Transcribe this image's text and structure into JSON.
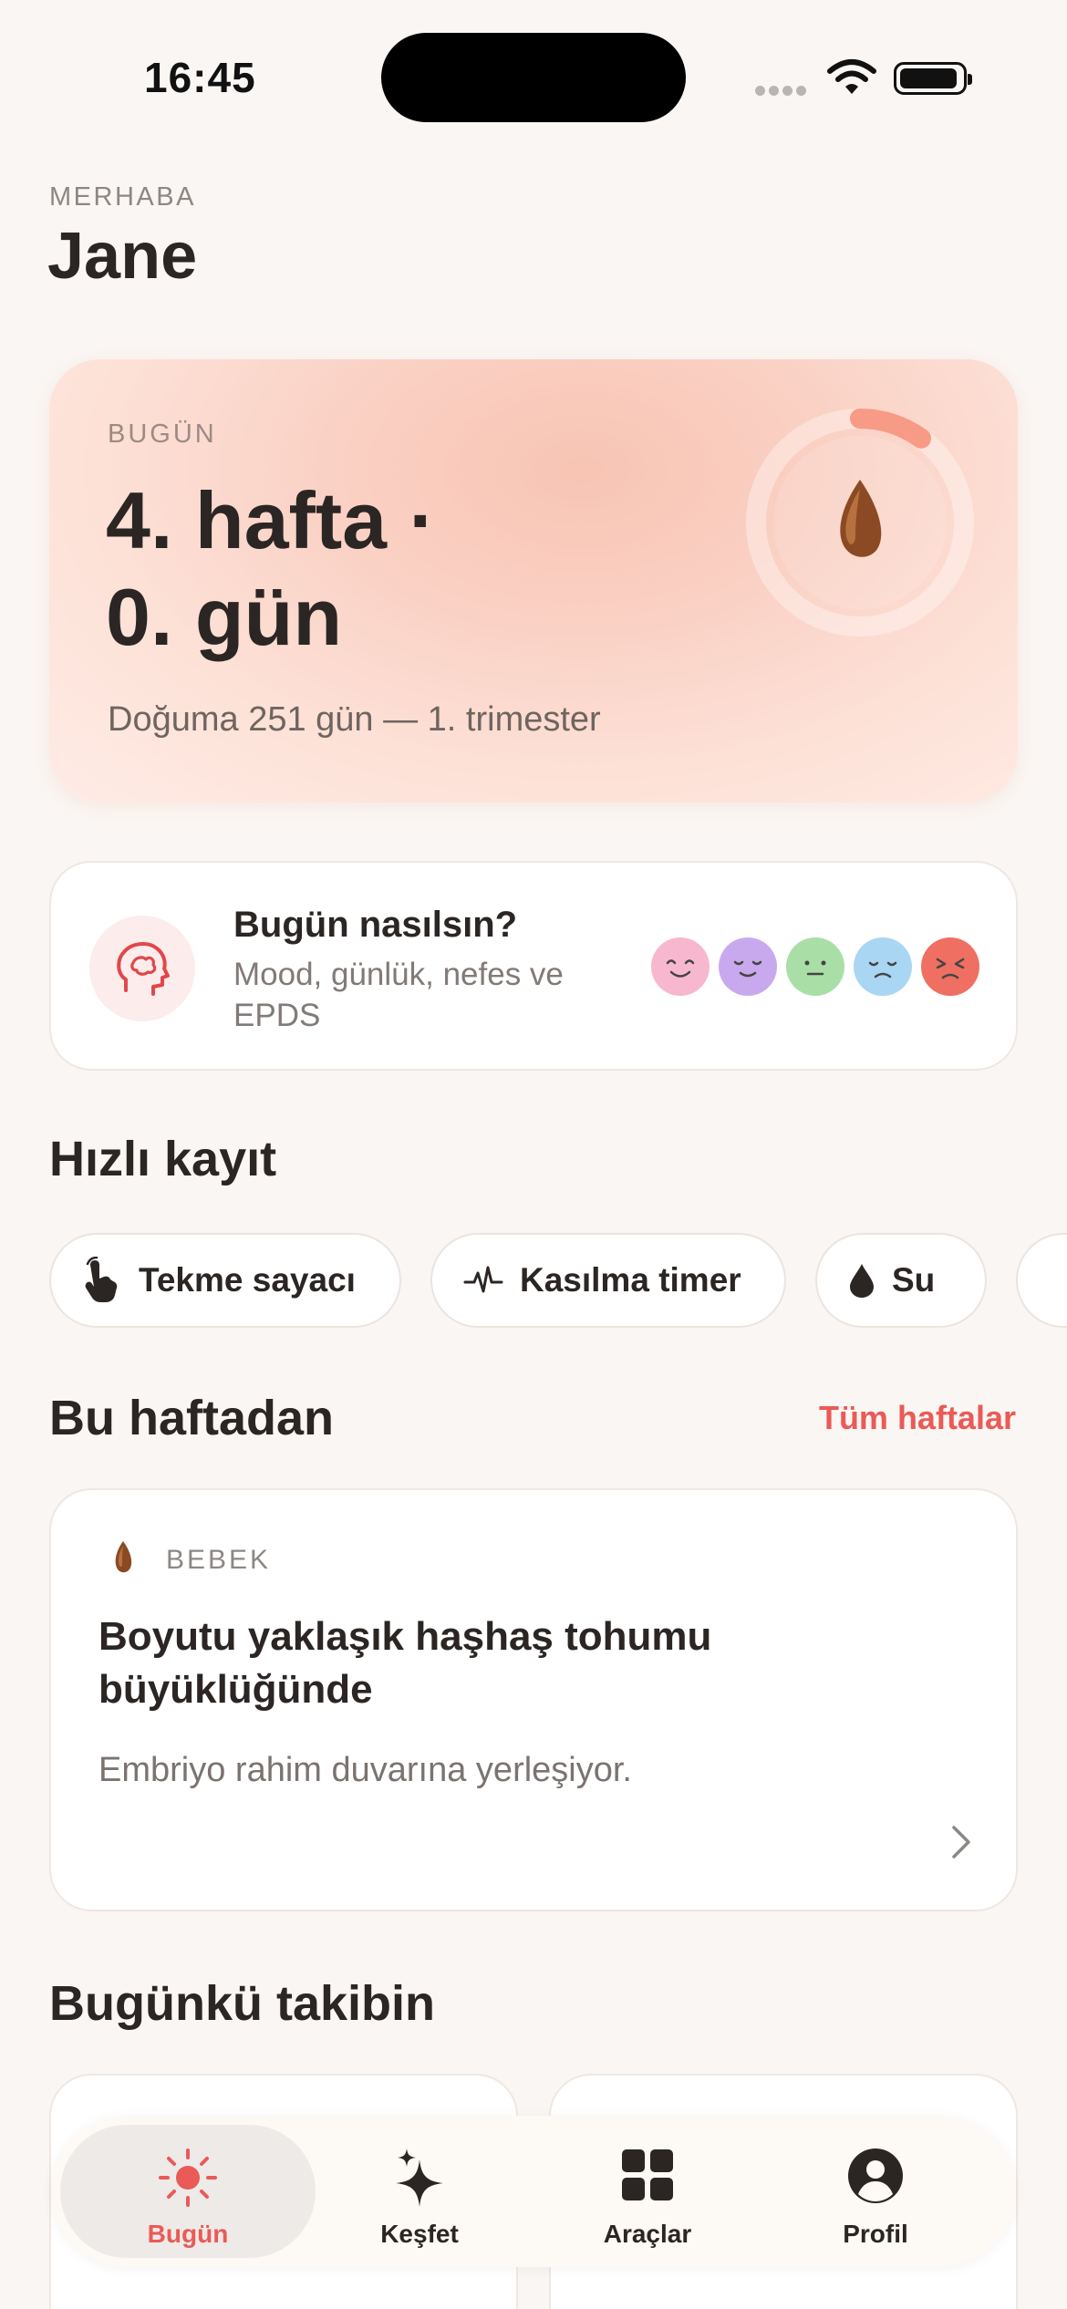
{
  "status_bar": {
    "time": "16:45"
  },
  "greeting": {
    "label": "MERHABA",
    "name": "Jane"
  },
  "hero": {
    "label": "BUGÜN",
    "week_line1": "4. hafta ·",
    "week_line2": "0. gün",
    "subtitle": "Doğuma 251 gün — 1. trimester",
    "progress_fraction": 0.1
  },
  "mood_card": {
    "title": "Bugün nasılsın?",
    "subtitle": "Mood, günlük, nefes ve EPDS",
    "faces": [
      {
        "name": "happy-face-icon",
        "color": "#f7b8cf"
      },
      {
        "name": "content-face-icon",
        "color": "#c9a9ee"
      },
      {
        "name": "neutral-face-icon",
        "color": "#a9dfa6"
      },
      {
        "name": "sad-face-icon",
        "color": "#a9d6f2"
      },
      {
        "name": "angry-face-icon",
        "color": "#ef6f62"
      }
    ]
  },
  "quick_log": {
    "title": "Hızlı kayıt",
    "chips": [
      {
        "label": "Tekme sayacı",
        "icon": "hand-tap-icon"
      },
      {
        "label": "Kasılma timer",
        "icon": "heartbeat-icon"
      },
      {
        "label": "Su",
        "icon": "water-drop-icon"
      }
    ]
  },
  "this_week": {
    "title": "Bu haftadan",
    "link": "Tüm haftalar",
    "card": {
      "tag": "BEBEK",
      "heading": "Boyutu yaklaşık haşhaş tohumu büyüklüğünde",
      "description": "Embriyo rahim duvarına yerleşiyor."
    }
  },
  "tracking": {
    "title": "Bugünkü takibin"
  },
  "tab_bar": {
    "tabs": [
      {
        "label": "Bugün",
        "icon": "sun-icon",
        "active": true
      },
      {
        "label": "Keşfet",
        "icon": "sparkle-icon",
        "active": false
      },
      {
        "label": "Araçlar",
        "icon": "grid-icon",
        "active": false
      },
      {
        "label": "Profil",
        "icon": "profile-icon",
        "active": false
      }
    ]
  },
  "colors": {
    "accent": "#ea5a57",
    "background": "#faf6f3",
    "hero_gradient": "#f8c4b4",
    "ring_progress": "#f79a86"
  }
}
